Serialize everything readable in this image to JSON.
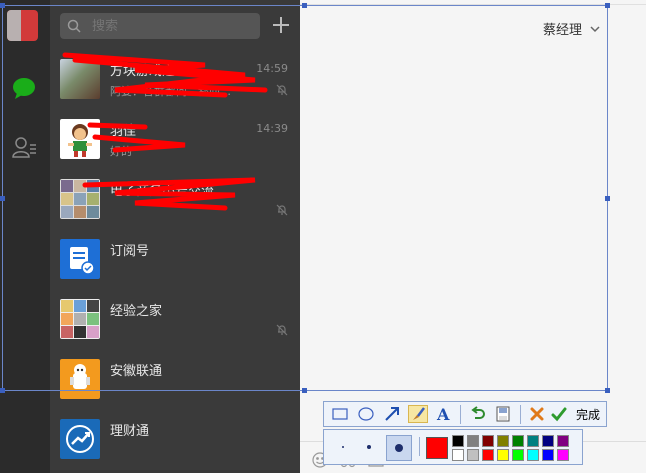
{
  "search": {
    "placeholder": "搜索"
  },
  "chats": [
    {
      "name": "方块游戏之家",
      "preview": "阿婆：各群都问…都问…",
      "time": "14:59",
      "muted": true,
      "avatar": "group-photo"
    },
    {
      "name": "羽佳",
      "preview": "好的",
      "time": "14:39",
      "muted": false,
      "avatar": "cartoon"
    },
    {
      "name": "电子商务小号交流",
      "preview": "",
      "time": "",
      "muted": true,
      "avatar": "group-grid"
    },
    {
      "name": "订阅号",
      "preview": "",
      "time": "",
      "muted": false,
      "avatar": "subscription"
    },
    {
      "name": "经验之家",
      "preview": "",
      "time": "",
      "muted": true,
      "avatar": "group-grid"
    },
    {
      "name": "安徽联通",
      "preview": "",
      "time": "",
      "muted": false,
      "avatar": "robot"
    },
    {
      "name": "理财通",
      "preview": "",
      "time": "",
      "muted": false,
      "avatar": "finance"
    }
  ],
  "chat_header": {
    "title": "蔡经理"
  },
  "screenshot_toolbar": {
    "tools": [
      "rectangle",
      "ellipse",
      "arrow",
      "brush",
      "text",
      "undo",
      "save",
      "cancel",
      "done"
    ],
    "done_label": "完成",
    "brush_sizes": [
      "small",
      "medium",
      "large"
    ],
    "selected_color": "#ff0000",
    "palette": [
      "#000000",
      "#808080",
      "#800000",
      "#808000",
      "#008000",
      "#008080",
      "#000080",
      "#800080",
      "#ffffff",
      "#c0c0c0",
      "#ff0000",
      "#ffff00",
      "#00ff00",
      "#00ffff",
      "#0000ff",
      "#ff00ff"
    ]
  },
  "colors": {
    "sidebar": "#2b2b2b",
    "chat_list": "#3a3a3a",
    "selection_border": "#6b86c9",
    "redaction": "#ff0000"
  }
}
